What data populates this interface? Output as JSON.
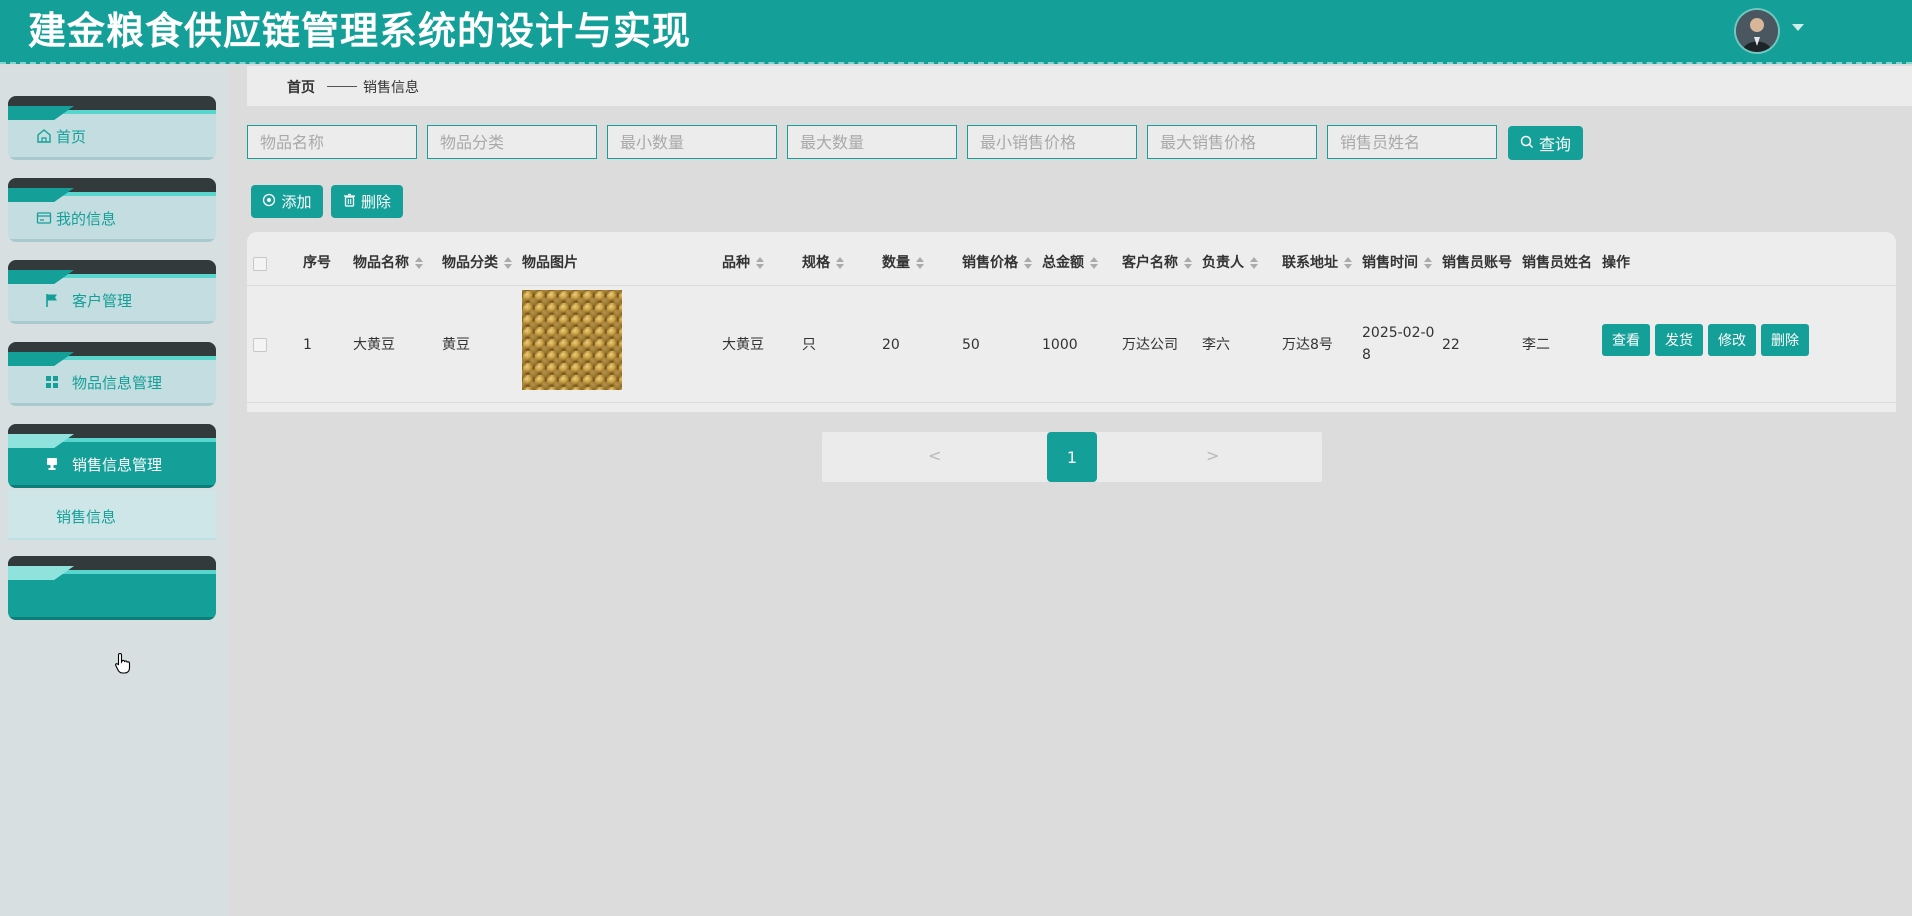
{
  "header": {
    "title": "建金粮食供应链管理系统的设计与实现"
  },
  "sidebar": {
    "items": [
      {
        "label": "首页",
        "icon": "home-icon"
      },
      {
        "label": "我的信息",
        "icon": "id-card-icon"
      },
      {
        "label": "客户管理",
        "icon": "flag-icon"
      },
      {
        "label": "物品信息管理",
        "icon": "grid-icon"
      },
      {
        "label": "销售信息管理",
        "icon": "stamp-icon"
      },
      {
        "label": "",
        "icon": ""
      }
    ],
    "submenu": {
      "label": "销售信息"
    }
  },
  "breadcrumb": {
    "home": "首页",
    "current": "销售信息"
  },
  "search": {
    "placeholders": [
      "物品名称",
      "物品分类",
      "最小数量",
      "最大数量",
      "最小销售价格",
      "最大销售价格",
      "销售员姓名"
    ],
    "button_label": "查询"
  },
  "actions": {
    "add_label": "添加",
    "delete_label": "删除"
  },
  "table": {
    "headers": [
      "序号",
      "物品名称",
      "物品分类",
      "物品图片",
      "品种",
      "规格",
      "数量",
      "销售价格",
      "总金额",
      "客户名称",
      "负责人",
      "联系地址",
      "销售时间",
      "销售员账号",
      "销售员姓名",
      "操作"
    ],
    "rows": [
      {
        "index": "1",
        "name": "大黄豆",
        "category": "黄豆",
        "variety": "大黄豆",
        "spec": "只",
        "quantity": "20",
        "price": "50",
        "total": "1000",
        "customer": "万达公司",
        "manager": "李六",
        "address": "万达8号",
        "time_line1": "2025-02-0",
        "time_line2": "8",
        "account": "22",
        "seller": "李二",
        "ops": [
          "查看",
          "发货",
          "修改",
          "删除"
        ]
      }
    ]
  },
  "pagination": {
    "prev": "<",
    "current_page": "1",
    "next": ">"
  },
  "colors": {
    "accent": "#14a098"
  }
}
